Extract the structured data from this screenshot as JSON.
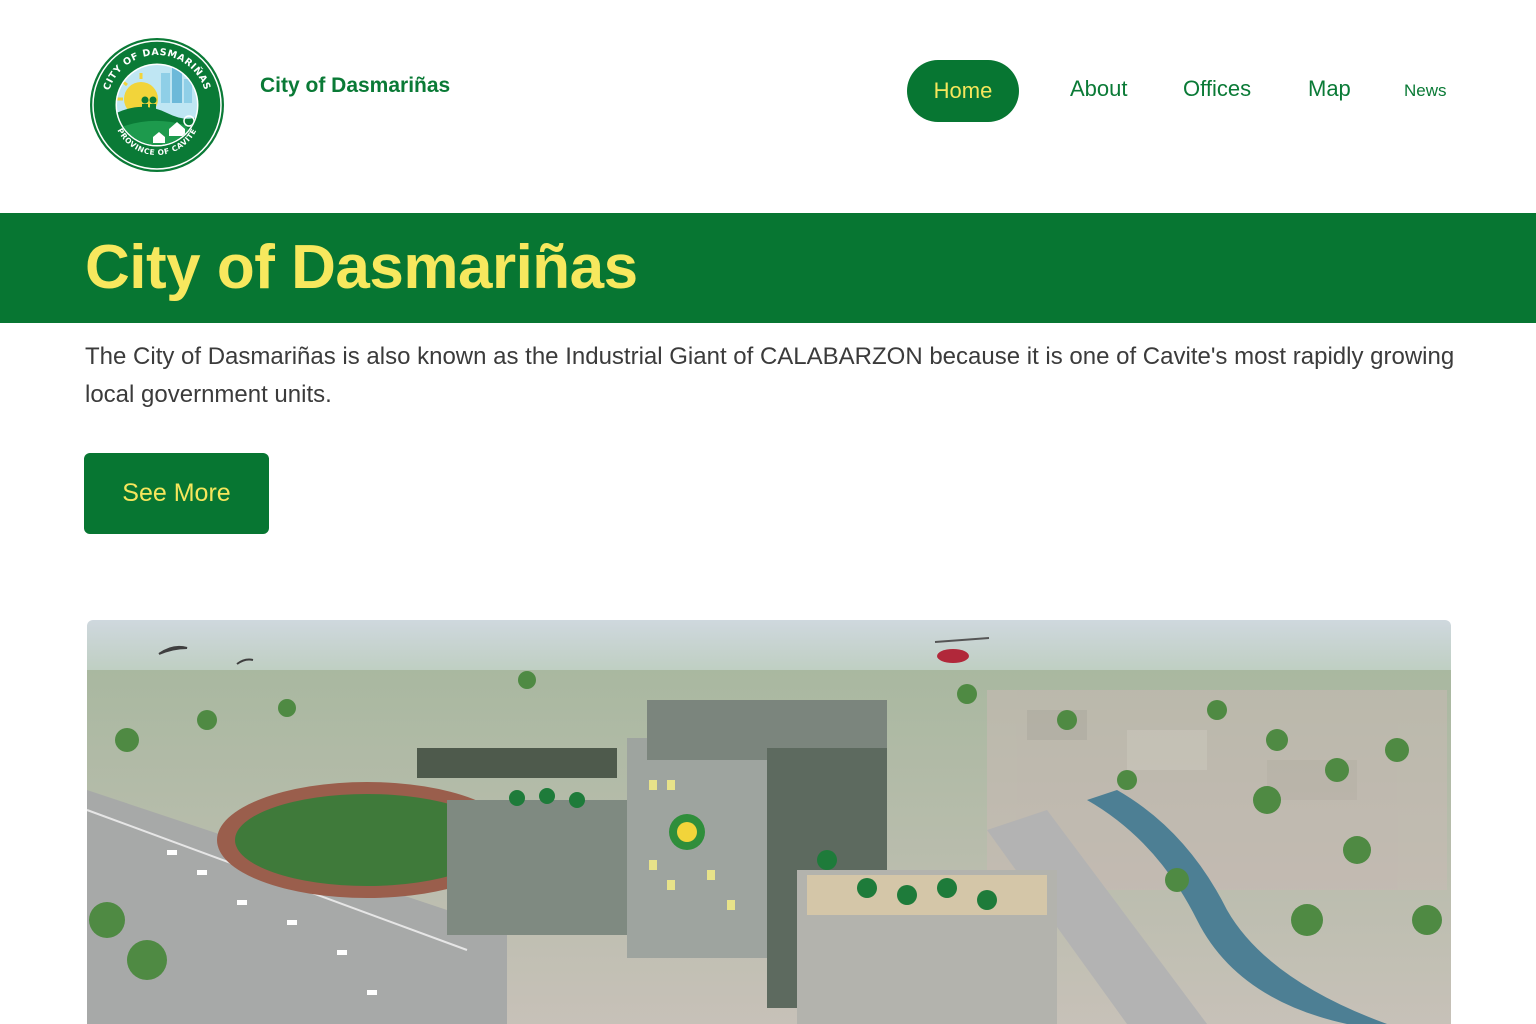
{
  "header": {
    "brand": "City of Dasmariñas",
    "seal": {
      "ring_top_text": "CITY OF DASMARIÑAS",
      "ring_bottom_text": "PROVINCE OF CAVITE",
      "colors": {
        "green": "#0a7a36",
        "sun": "#f2d43a",
        "sky": "#7fc7e9"
      }
    },
    "nav": {
      "home": "Home",
      "about": "About",
      "offices": "Offices",
      "map": "Map",
      "news": "News",
      "active": "Home"
    }
  },
  "hero": {
    "title": "City of Dasmariñas",
    "description": "The City of Dasmariñas is also known as the Industrial Giant of CALABARZON because it is one of Cavite's most rapidly growing local government units.",
    "cta_label": "See More"
  },
  "image": {
    "subject": "aerial-rendering-city-hall"
  },
  "colors": {
    "primary_green": "#077632",
    "accent_yellow": "#f7e85e",
    "body_text": "#3b3b3b"
  }
}
